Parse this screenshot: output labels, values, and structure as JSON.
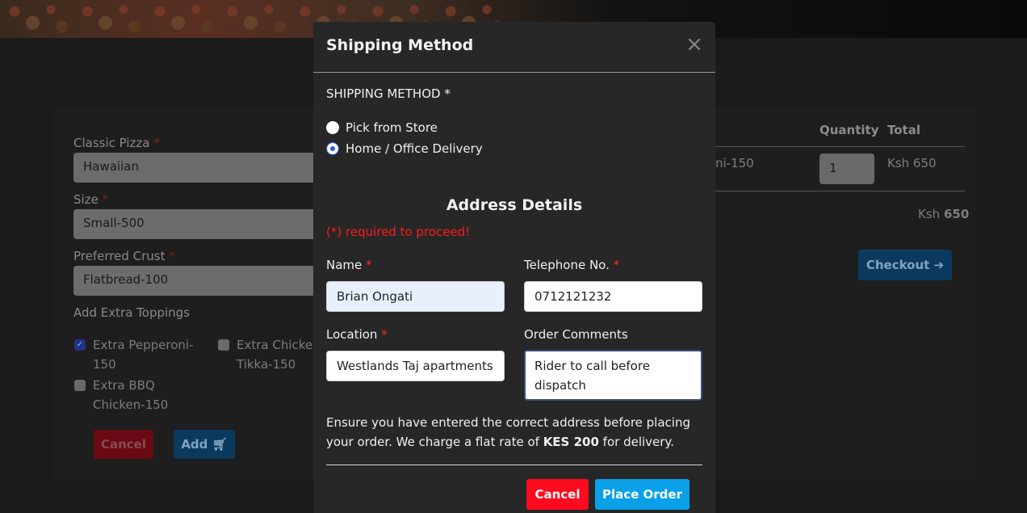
{
  "background": {
    "form": {
      "classic_pizza_label": "Classic Pizza",
      "classic_pizza_value": "Hawaiian",
      "size_label": "Size",
      "size_value": "Small-500",
      "crust_label": "Preferred Crust",
      "crust_value": "Flatbread-100",
      "toppings_label": "Add Extra Toppings",
      "required_mark": "*",
      "toppings": [
        {
          "label_line1": "Extra Pepperoni-",
          "label_line2": "150",
          "checked": true
        },
        {
          "label_line1": "Extra Chicken",
          "label_line2": "Tikka-150",
          "checked": false
        },
        {
          "label_line1": "Extra BBQ",
          "label_line2": "Chicken-150",
          "checked": false
        }
      ],
      "cancel_label": "Cancel",
      "add_label": "Add",
      "add_icon": "cart-icon"
    },
    "cart": {
      "col_quantity": "Quantity",
      "col_total": "Total",
      "row_item_partial": "ni-150",
      "row_qty": "1",
      "row_total": "Ksh 650",
      "grand_total_prefix": "Ksh",
      "grand_total_value": "650",
      "checkout_label": "Checkout",
      "checkout_icon": "arrow-circle-right-icon"
    }
  },
  "modal": {
    "title": "Shipping Method",
    "close_glyph": "×",
    "shipping_section_label": "SHIPPING METHOD *",
    "options": [
      {
        "label": "Pick from Store",
        "selected": false
      },
      {
        "label": "Home / Office Delivery",
        "selected": true
      }
    ],
    "address_title": "Address Details",
    "required_note": "(*) required to proceed!",
    "fields": {
      "name_label": "Name",
      "name_value": "Brian Ongati",
      "phone_label": "Telephone No.",
      "phone_value": "0712121232",
      "location_label": "Location",
      "location_value": "Westlands Taj apartments",
      "comments_label": "Order Comments",
      "comments_value": "Rider to call before dispatch"
    },
    "required_mark": "*",
    "note_text": "Ensure you have entered the correct address before placing your order. We charge a flat rate of ",
    "note_bold": "KES 200",
    "note_suffix": " for delivery.",
    "cancel_label": "Cancel",
    "place_order_label": "Place Order"
  },
  "colors": {
    "cancel_red": "#ff0a1e",
    "place_order_blue": "#0aa0e8",
    "required_red": "#ff1a1a",
    "radio_selected": "#2f5be0"
  }
}
